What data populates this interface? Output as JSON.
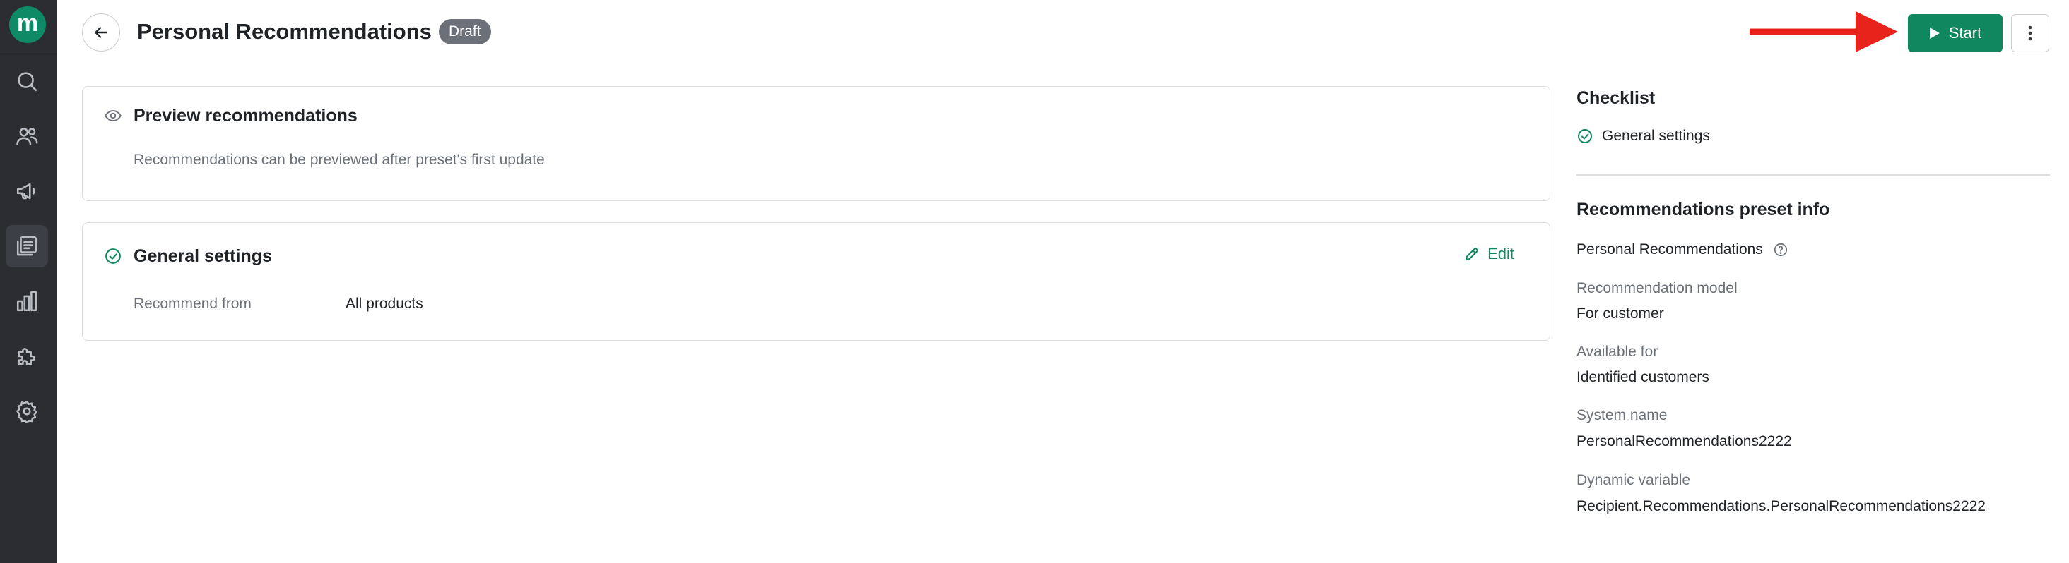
{
  "sidebar": {
    "logo_letter": "m",
    "items": [
      {
        "icon": "search-icon"
      },
      {
        "icon": "users-icon"
      },
      {
        "icon": "megaphone-icon"
      },
      {
        "icon": "recommendations-icon",
        "active": true
      },
      {
        "icon": "analytics-icon"
      },
      {
        "icon": "puzzle-icon"
      },
      {
        "icon": "gear-icon"
      }
    ]
  },
  "header": {
    "title": "Personal Recommendations",
    "status": "Draft",
    "start_label": "Start"
  },
  "preview_card": {
    "title": "Preview recommendations",
    "description": "Recommendations can be previewed after preset's first update"
  },
  "settings_card": {
    "title": "General settings",
    "edit_label": "Edit",
    "field_label": "Recommend from",
    "field_value": "All products"
  },
  "checklist": {
    "heading": "Checklist",
    "items": [
      "General settings"
    ]
  },
  "preset_info": {
    "heading": "Recommendations preset info",
    "name": "Personal Recommendations",
    "fields": [
      {
        "label": "Recommendation model",
        "value": "For customer"
      },
      {
        "label": "Available for",
        "value": "Identified customers"
      },
      {
        "label": "System name",
        "value": "PersonalRecommendations2222"
      },
      {
        "label": "Dynamic variable",
        "value": "Recipient.Recommendations.PersonalRecommendations2222"
      }
    ]
  },
  "colors": {
    "accent": "#11875f",
    "sidebar_bg": "#2b2d31",
    "badge_bg": "#6b7079",
    "arrow": "#e8231b"
  }
}
